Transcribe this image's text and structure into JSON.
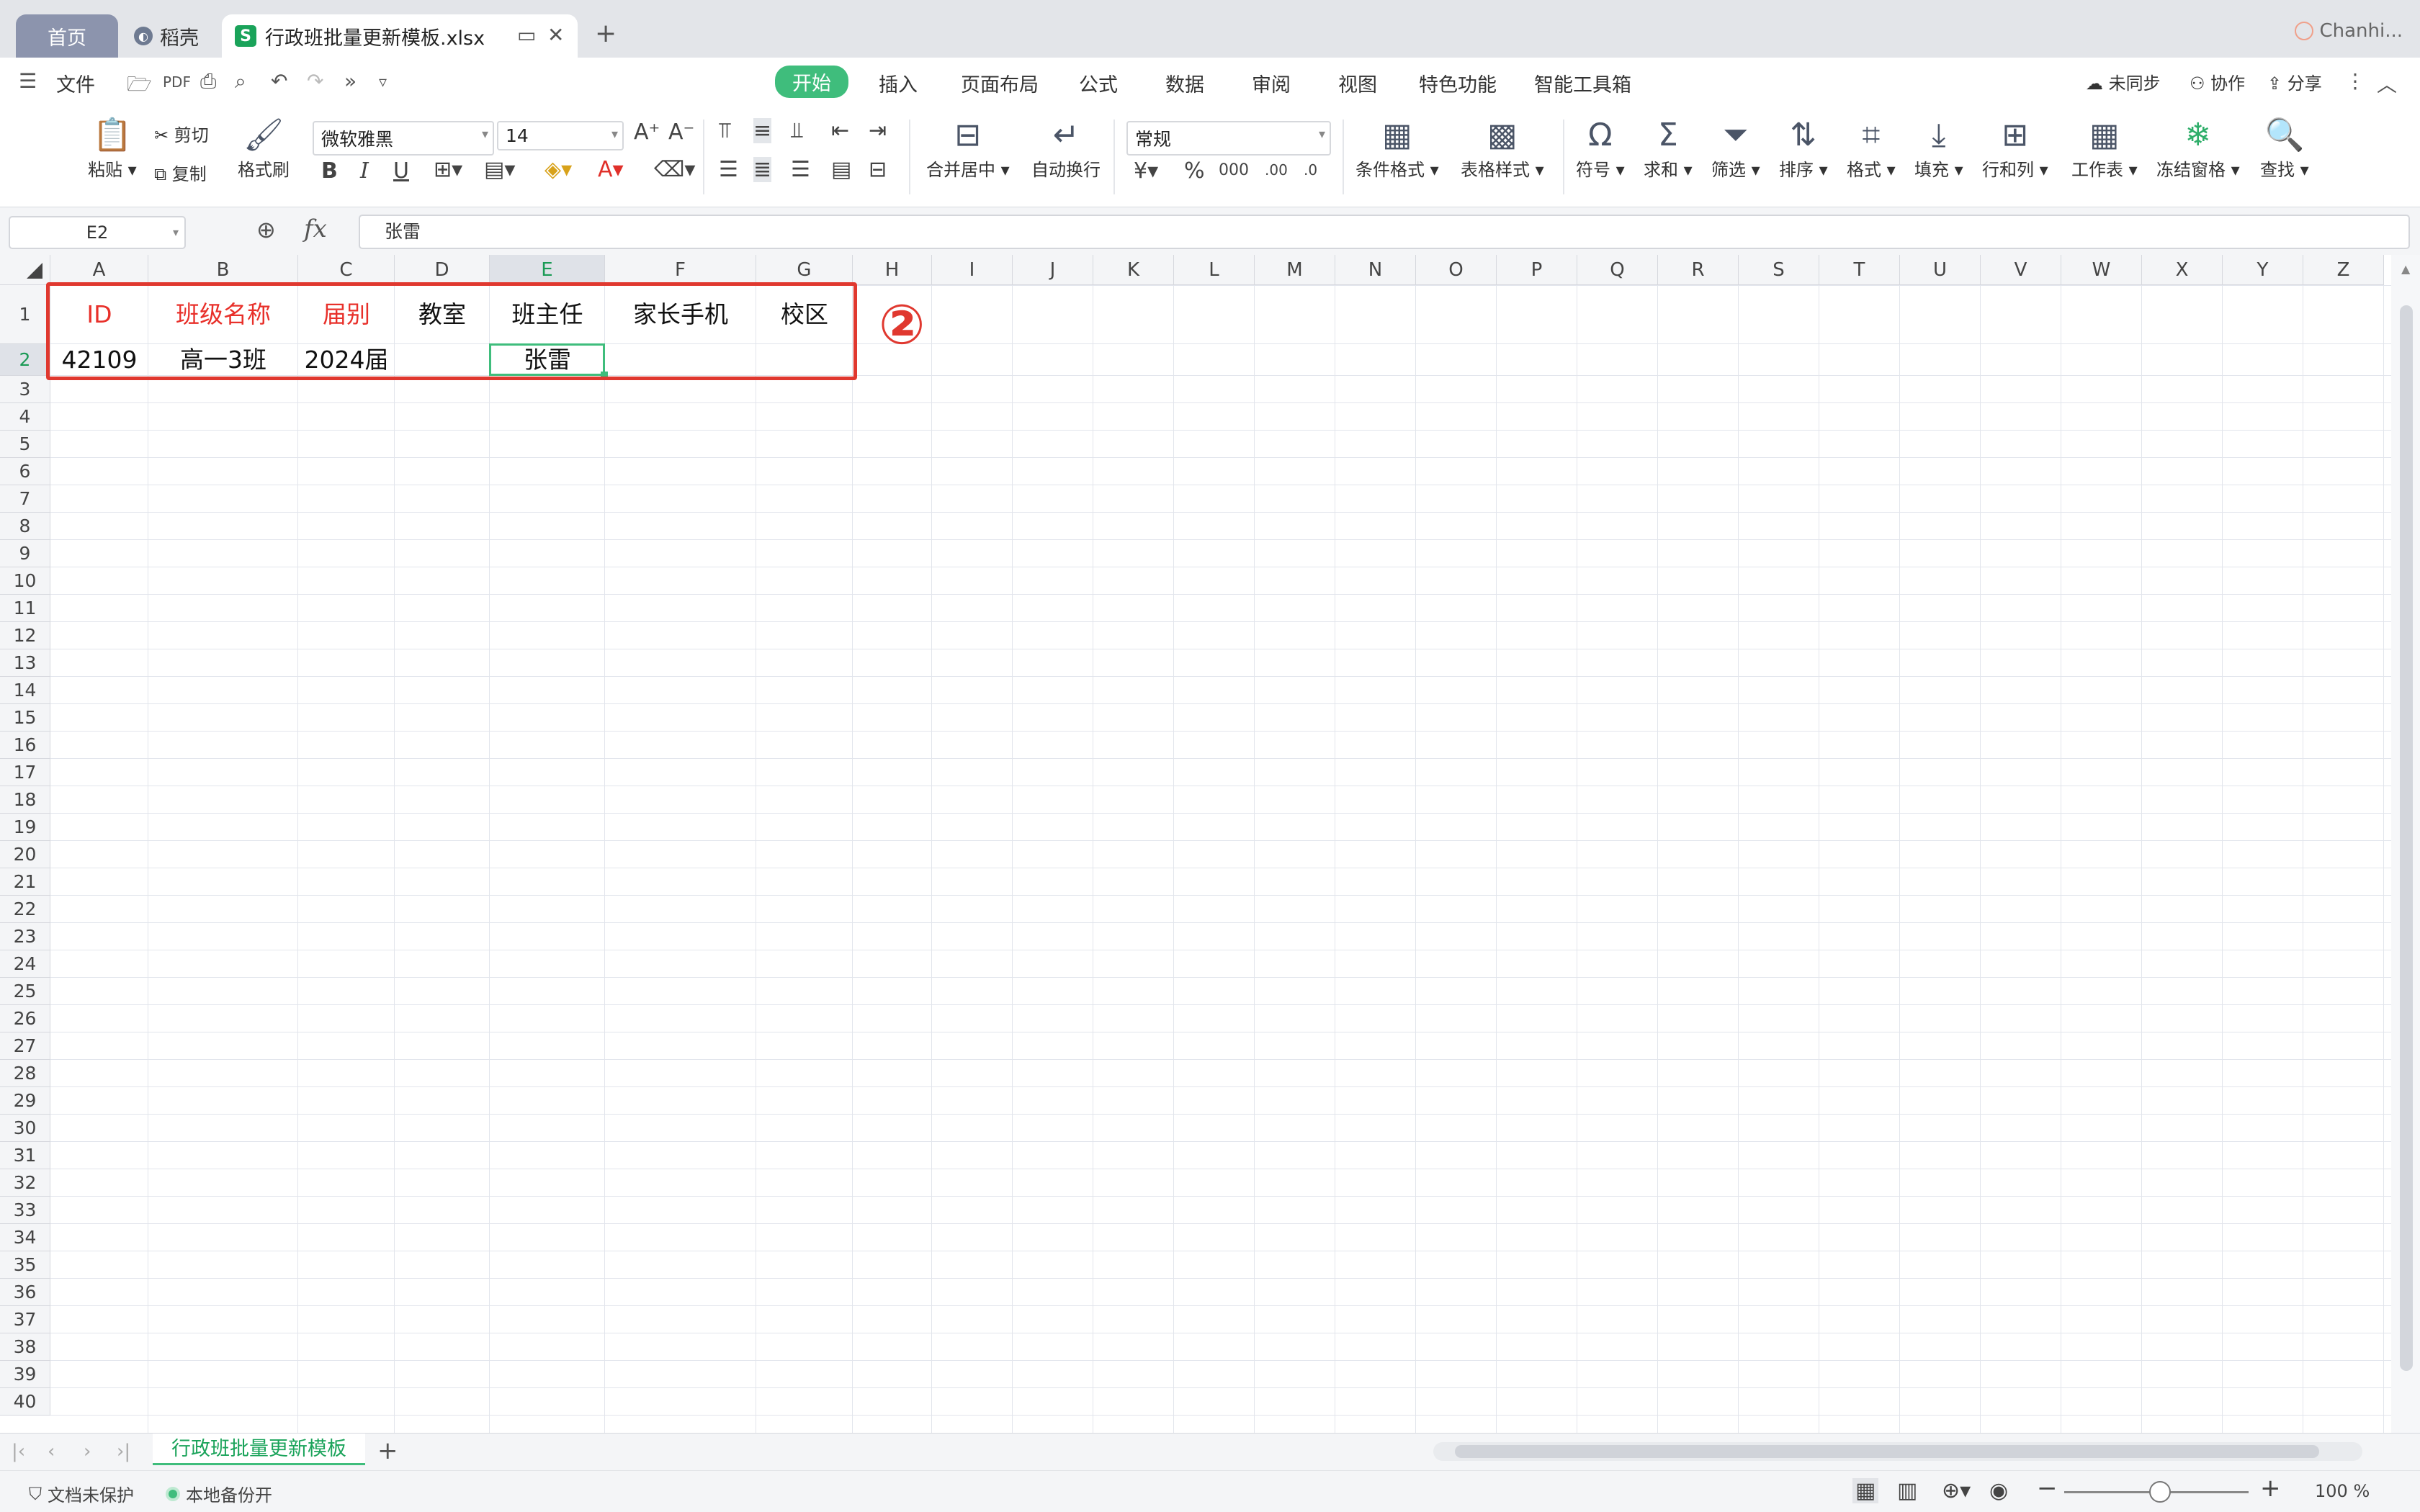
{
  "titlebar": {
    "tab_home": "首页",
    "tab_daoke": "稻壳",
    "tab_file": "行政班批量更新模板.xlsx",
    "file_icon": "S",
    "user": "Chanhi..."
  },
  "menu": {
    "file": "文件",
    "tabs": [
      "开始",
      "插入",
      "页面布局",
      "公式",
      "数据",
      "审阅",
      "视图",
      "特色功能",
      "智能工具箱"
    ],
    "sync": "未同步",
    "collab": "协作",
    "share": "分享"
  },
  "ribbon": {
    "paste": "粘贴",
    "cut": "剪切",
    "copy": "复制",
    "format_painter": "格式刷",
    "font_name": "微软雅黑",
    "font_size": "14",
    "merge_center": "合并居中",
    "wrap_text": "自动换行",
    "number_format": "常规",
    "conditional_format": "条件格式",
    "table_style": "表格样式",
    "symbol": "符号",
    "sum": "求和",
    "filter": "筛选",
    "sort": "排序",
    "format": "格式",
    "fill": "填充",
    "row_col": "行和列",
    "worksheet": "工作表",
    "freeze": "冻结窗格",
    "find": "查找"
  },
  "formula_bar": {
    "name_box": "E2",
    "fx": "fx",
    "content": "张雷"
  },
  "grid": {
    "columns": [
      "A",
      "B",
      "C",
      "D",
      "E",
      "F",
      "G",
      "H",
      "I",
      "J",
      "K",
      "L",
      "M",
      "N",
      "O",
      "P",
      "Q",
      "R",
      "S",
      "T",
      "U",
      "V",
      "W",
      "X",
      "Y",
      "Z"
    ],
    "rows": [
      "1",
      "2",
      "3",
      "4",
      "5",
      "6",
      "7",
      "8",
      "9",
      "10",
      "11",
      "12",
      "13",
      "14",
      "15",
      "16",
      "17",
      "18",
      "19",
      "20",
      "21",
      "22",
      "23",
      "24",
      "25",
      "26",
      "27",
      "28",
      "29",
      "30",
      "31",
      "32",
      "33",
      "34",
      "35",
      "36",
      "37",
      "38",
      "39",
      "40"
    ],
    "header_row": [
      "ID",
      "班级名称",
      "届别",
      "教室",
      "班主任",
      "家长手机",
      "校区"
    ],
    "data_row": [
      "42109",
      "高一3班",
      "2024届",
      "",
      "张雷",
      "",
      ""
    ],
    "selected_cell": "E2",
    "annotation": "②"
  },
  "sheets": {
    "active": "行政班批量更新模板"
  },
  "status": {
    "protect": "文档未保护",
    "backup": "本地备份开",
    "zoom": "100 %"
  },
  "colors": {
    "accent": "#3fbd7c",
    "required_header": "#e8302a",
    "annotation": "#e0382f"
  }
}
